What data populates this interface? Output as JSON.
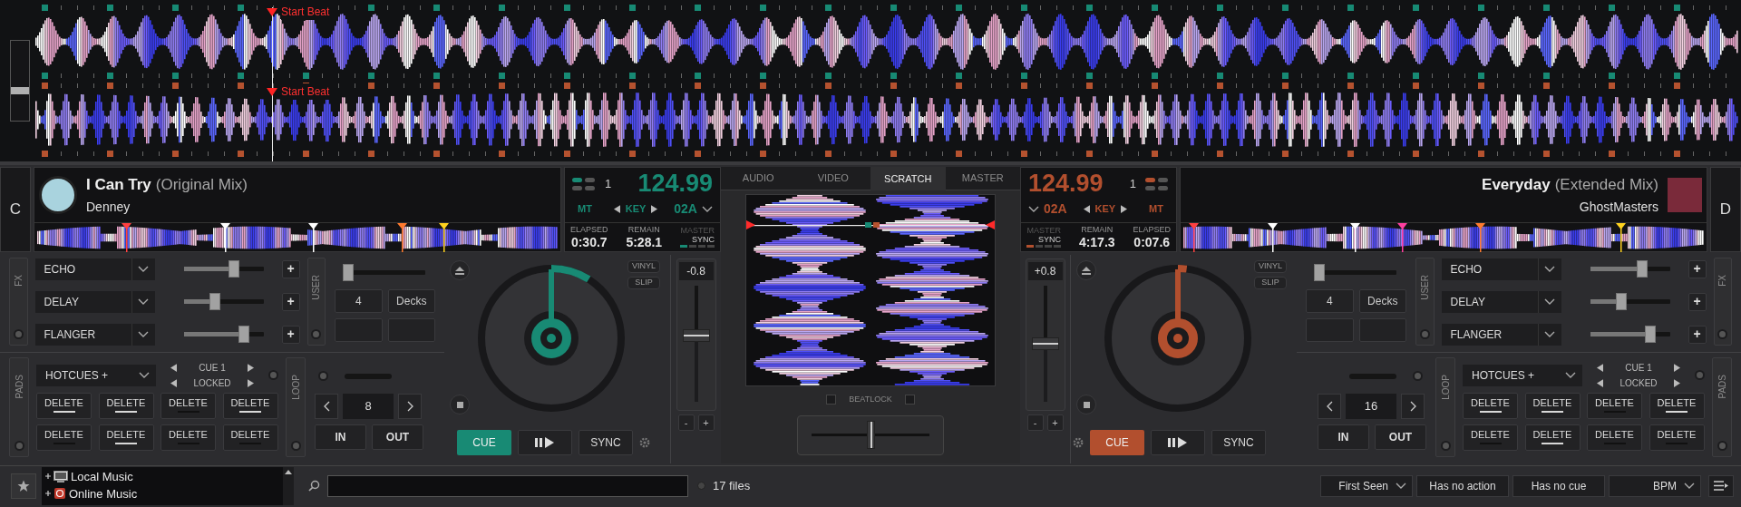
{
  "zoom_slider": {
    "level": 0.37
  },
  "top_waveforms": [
    {
      "marker_label": "Start Beat"
    },
    {
      "marker_label": "Start Beat"
    }
  ],
  "decks": [
    {
      "deck_letter": "C",
      "title": "I Can Try",
      "version": "(Original Mix)",
      "artist": "Denney",
      "color": "#188a74",
      "deck_number": "1",
      "bpm": "124.99",
      "mt": "MT",
      "key_label": "KEY",
      "key": "02A",
      "elapsed_label": "ELAPSED",
      "elapsed": "0:30.7",
      "remain_label": "REMAIN",
      "remain": "5:28.1",
      "master_label": "MASTER",
      "master_on": false,
      "sync_label": "SYNC",
      "sync_on": true,
      "fx_label": "FX",
      "fx": [
        {
          "name": "ECHO",
          "level": 0.63,
          "add": "+"
        },
        {
          "name": "DELAY",
          "level": 0.39,
          "add": "+"
        },
        {
          "name": "FLANGER",
          "level": 0.75,
          "add": "+"
        }
      ],
      "user_label": "USER",
      "user_slider": {
        "level": 0.05
      },
      "user_buttons": [
        "4",
        "Decks"
      ],
      "pads_label": "PADS",
      "pads_mode": "HOTCUES +",
      "cue_label": "CUE 1",
      "lock_label": "LOCKED",
      "pads": [
        {
          "label": "DELETE",
          "on": true
        },
        {
          "label": "DELETE",
          "on": true
        },
        {
          "label": "DELETE",
          "on": false
        },
        {
          "label": "DELETE",
          "on": true
        },
        {
          "label": "DELETE",
          "on": false
        },
        {
          "label": "DELETE",
          "on": true
        },
        {
          "label": "DELETE",
          "on": false
        },
        {
          "label": "DELETE",
          "on": false
        }
      ],
      "loop_label": "LOOP",
      "loop_size": "8",
      "loop_in": "IN",
      "loop_out": "OUT",
      "vinyl": "VINYL",
      "slip": "SLIP",
      "pitch": "-0.8",
      "pitch_slider": {
        "level": 0.57
      },
      "pitch_minus": "-",
      "pitch_plus": "+",
      "cue": "CUE",
      "sync_button": "SYNC"
    },
    {
      "deck_letter": "D",
      "title": "Everyday",
      "version": "(Extended Mix)",
      "artist": "GhostMasters",
      "color": "#b24f2e",
      "deck_number": "1",
      "bpm": "124.99",
      "mt": "MT",
      "key_label": "KEY",
      "key": "02A",
      "elapsed_label": "ELAPSED",
      "elapsed": "0:07.6",
      "remain_label": "REMAIN",
      "remain": "4:17.3",
      "master_label": "MASTER",
      "master_on": false,
      "sync_label": "SYNC",
      "sync_on": true,
      "fx_label": "FX",
      "fx": [
        {
          "name": "ECHO",
          "level": 0.65,
          "add": "+"
        },
        {
          "name": "DELAY",
          "level": 0.39,
          "add": "+"
        },
        {
          "name": "FLANGER",
          "level": 0.76,
          "add": "+"
        }
      ],
      "user_label": "USER",
      "user_slider": {
        "level": 0.05
      },
      "user_buttons": [
        "4",
        "Decks"
      ],
      "pads_label": "PADS",
      "pads_mode": "HOTCUES +",
      "cue_label": "CUE 1",
      "lock_label": "LOCKED",
      "pads": [
        {
          "label": "DELETE",
          "on": true
        },
        {
          "label": "DELETE",
          "on": true
        },
        {
          "label": "DELETE",
          "on": false
        },
        {
          "label": "DELETE",
          "on": true
        },
        {
          "label": "DELETE",
          "on": false
        },
        {
          "label": "DELETE",
          "on": true
        },
        {
          "label": "DELETE",
          "on": false
        },
        {
          "label": "DELETE",
          "on": false
        }
      ],
      "loop_label": "LOOP",
      "loop_size": "16",
      "loop_in": "IN",
      "loop_out": "OUT",
      "vinyl": "VINYL",
      "slip": "SLIP",
      "pitch": "+0.8",
      "pitch_slider": {
        "level": 0.5
      },
      "pitch_minus": "-",
      "pitch_plus": "+",
      "cue": "CUE",
      "sync_button": "SYNC"
    }
  ],
  "center": {
    "tabs": [
      {
        "label": "AUDIO",
        "selected": false
      },
      {
        "label": "VIDEO",
        "selected": false
      },
      {
        "label": "SCRATCH",
        "selected": true
      },
      {
        "label": "MASTER",
        "selected": false
      }
    ],
    "beatlock_label": "BEATLOCK",
    "beatlock": [
      {
        "checked": false
      },
      {
        "checked": false
      }
    ],
    "crossfader": {
      "level": 0.5
    }
  },
  "browser": {
    "folders": [
      {
        "label": "Local Music"
      },
      {
        "label": "Online Music"
      }
    ],
    "file_count": "17 files",
    "filters": [
      {
        "kind": "dropdown",
        "label": "First Seen"
      },
      {
        "kind": "button",
        "label": "Has no action"
      },
      {
        "kind": "button",
        "label": "Has no cue"
      },
      {
        "kind": "dropdown",
        "label": "BPM"
      }
    ]
  }
}
